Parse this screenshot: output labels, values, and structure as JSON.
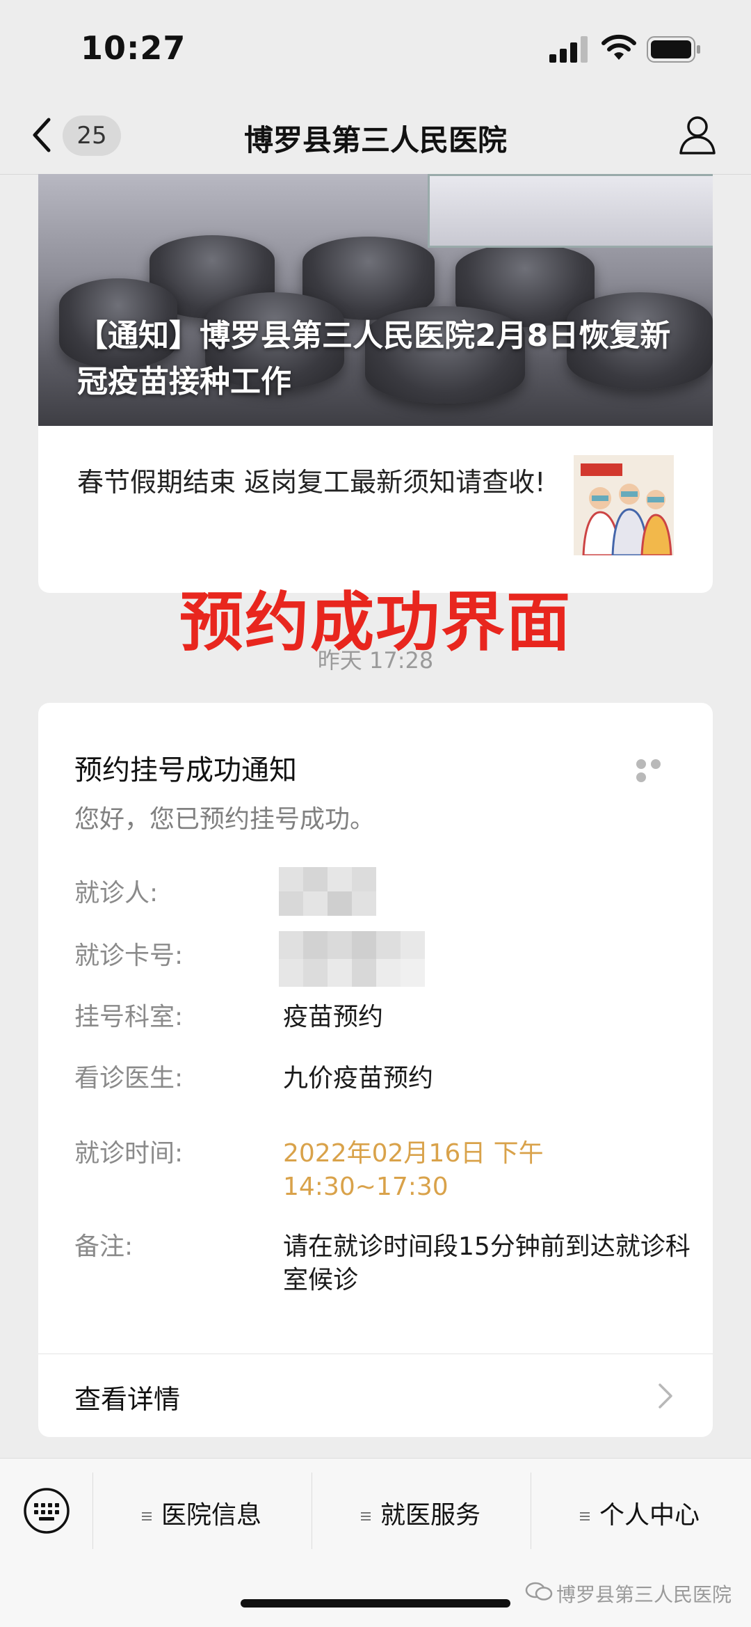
{
  "status_bar": {
    "time": "10:27"
  },
  "nav": {
    "back_count": "25",
    "title": "博罗县第三人民医院"
  },
  "article": {
    "cover_title": "【通知】博罗县第三人民医院2月8日恢复新冠疫苗接种工作",
    "sub_title": "春节假期结束 返岗复工最新须知请查收!"
  },
  "annotation": "预约成功界面",
  "timestamp": "昨天 17:28",
  "notice": {
    "title": "预约挂号成功通知",
    "greeting": "您好，您已预约挂号成功。",
    "fields": [
      {
        "label": "就诊人:",
        "value": ""
      },
      {
        "label": "就诊卡号:",
        "value": ""
      },
      {
        "label": "挂号科室:",
        "value": "疫苗预约"
      },
      {
        "label": "看诊医生:",
        "value": "九价疫苗预约"
      },
      {
        "label": "就诊时间:",
        "value": "2022年02月16日 下午 14:30~17:30"
      },
      {
        "label": "备注:",
        "value": "请在就诊时间段15分钟前到达就诊科室候诊"
      }
    ],
    "details_label": "查看详情"
  },
  "bottom_menu": [
    "医院信息",
    "就医服务",
    "个人中心"
  ],
  "watermark": "博罗县第三人民医院",
  "colors": {
    "accent_orange": "#d9a24a",
    "annotation_red": "#e8261e"
  },
  "icons": [
    "back-chevron-icon",
    "user-icon",
    "more-icon",
    "chevron-right-icon",
    "keyboard-icon",
    "menu-icon",
    "wechat-icon"
  ]
}
